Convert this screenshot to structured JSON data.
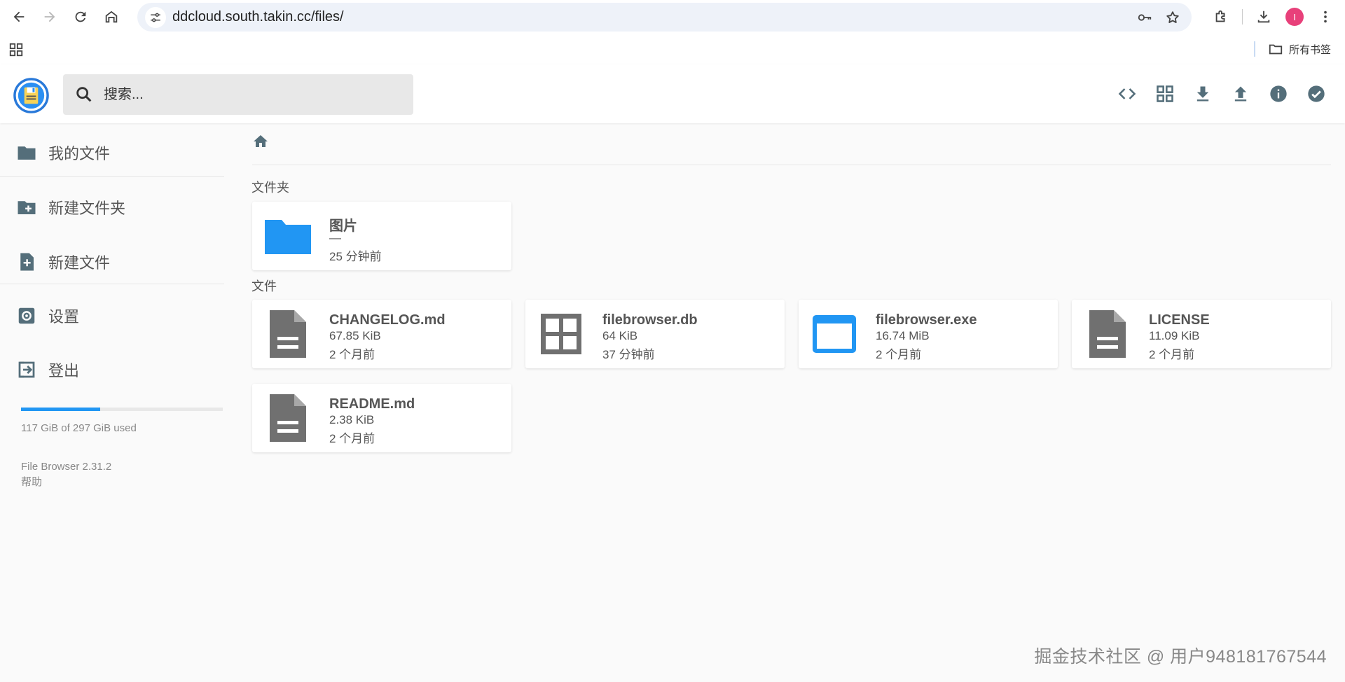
{
  "browser": {
    "url": "ddcloud.south.takin.cc/files/",
    "avatar_letter": "I",
    "bookmarks_all": "所有书签"
  },
  "app": {
    "search_placeholder": "搜索...",
    "sidebar": {
      "my_files": "我的文件",
      "new_folder": "新建文件夹",
      "new_file": "新建文件",
      "settings": "设置",
      "logout": "登出"
    },
    "usage": {
      "text": "117 GiB of 297 GiB used",
      "used_fraction": 0.394
    },
    "version": "File Browser 2.31.2",
    "help": "帮助",
    "accent_color": "#2196f3"
  },
  "main": {
    "folders_label": "文件夹",
    "files_label": "文件",
    "folders": [
      {
        "name": "图片",
        "size": "—",
        "modified": "25 分钟前",
        "icon": "folder-icon"
      }
    ],
    "files": [
      {
        "name": "CHANGELOG.md",
        "size": "67.85 KiB",
        "modified": "2 个月前",
        "icon": "document-icon"
      },
      {
        "name": "filebrowser.db",
        "size": "64 KiB",
        "modified": "37 分钟前",
        "icon": "grid-file-icon"
      },
      {
        "name": "filebrowser.exe",
        "size": "16.74 MiB",
        "modified": "2 个月前",
        "icon": "application-window-icon"
      },
      {
        "name": "LICENSE",
        "size": "11.09 KiB",
        "modified": "2 个月前",
        "icon": "document-icon"
      },
      {
        "name": "README.md",
        "size": "2.38 KiB",
        "modified": "2 个月前",
        "icon": "document-icon"
      }
    ]
  },
  "watermark": "掘金技术社区 @ 用户948181767544"
}
